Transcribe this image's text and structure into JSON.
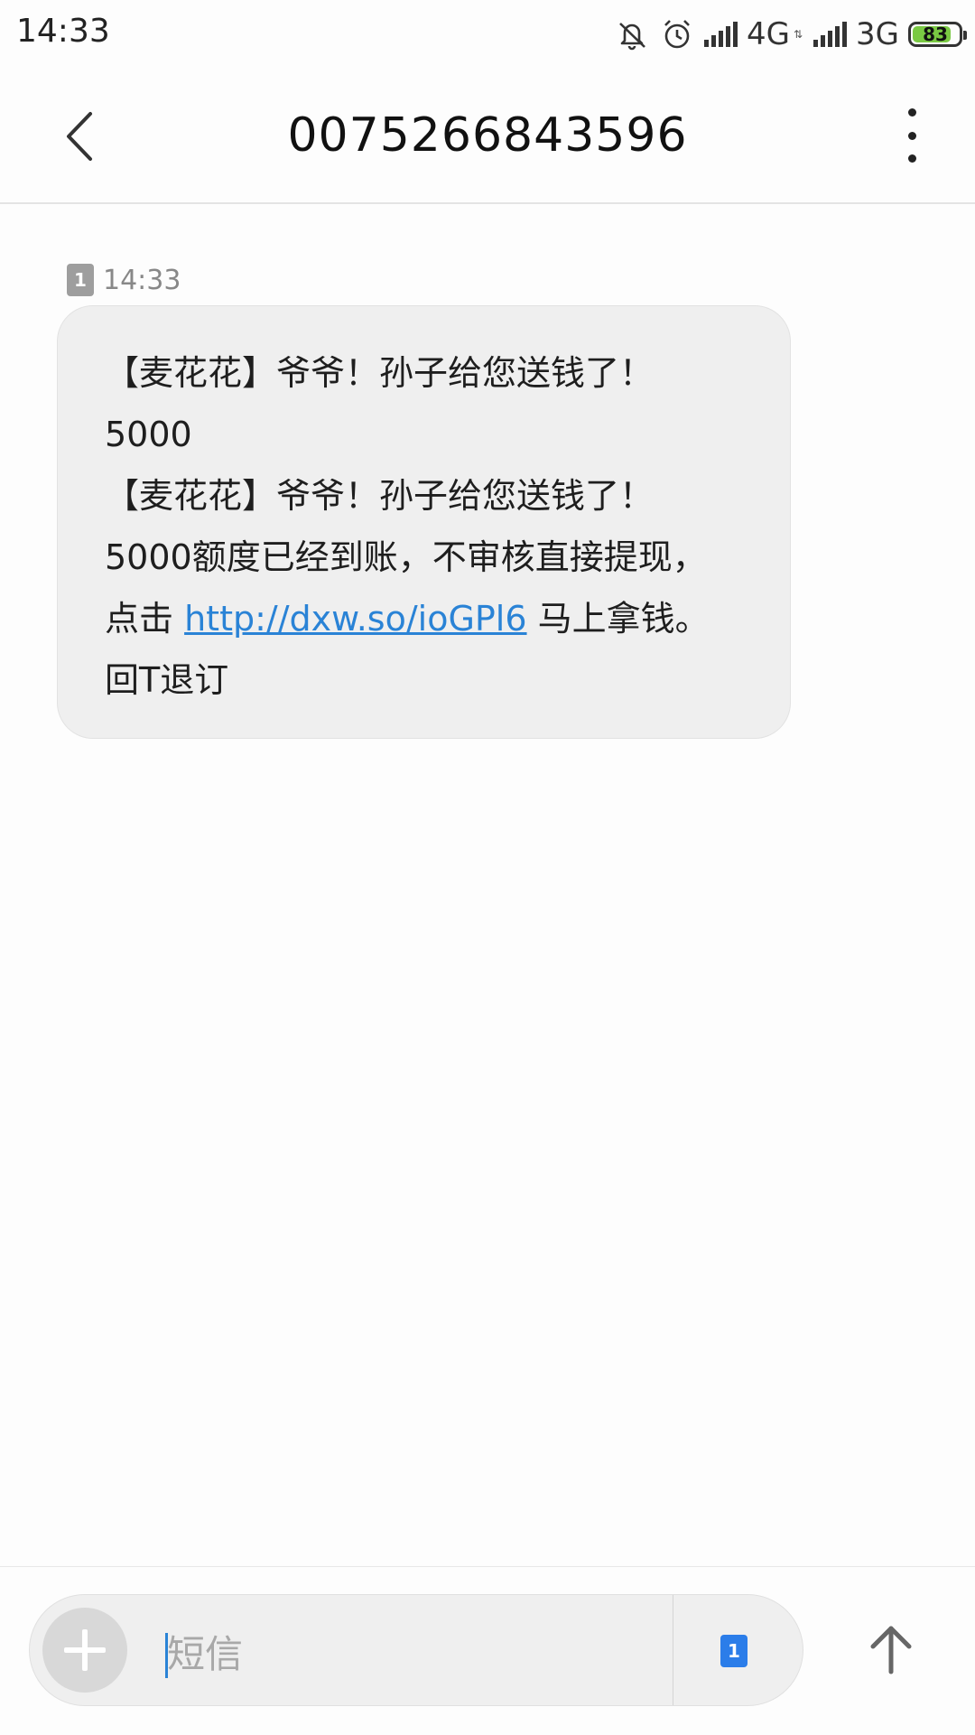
{
  "status_bar": {
    "time": "14:33",
    "icons": [
      "mute-icon",
      "alarm-icon",
      "signal-icon",
      "signal-icon",
      "battery-icon"
    ],
    "network1": "4G",
    "network2": "3G",
    "battery_percent": "83",
    "battery_level": 0.83,
    "battery_color": "#7ac943"
  },
  "header": {
    "title": "0075266843596",
    "back_icon": "chevron-left-icon",
    "more_icon": "more-vertical-icon"
  },
  "message": {
    "sim_slot": "1",
    "time": "14:33",
    "line1": "【麦花花】爷爷！孙子给您送钱了！",
    "line2": "5000",
    "line3": "【麦花花】爷爷！孙子给您送钱了！",
    "line4": "5000额度已经到账，不审核直接提现，",
    "line5_prefix": "点击 ",
    "link": "http://dxw.so/ioGPl6",
    "line5_suffix": " 马上拿钱。",
    "line6": "回T退订",
    "link_color": "#2a83d6",
    "bubble_color": "#efefef"
  },
  "composer": {
    "placeholder": "短信",
    "sim_slot": "1",
    "add_icon": "plus-icon",
    "send_icon": "arrow-up-icon",
    "accent": "#2b7de9"
  }
}
